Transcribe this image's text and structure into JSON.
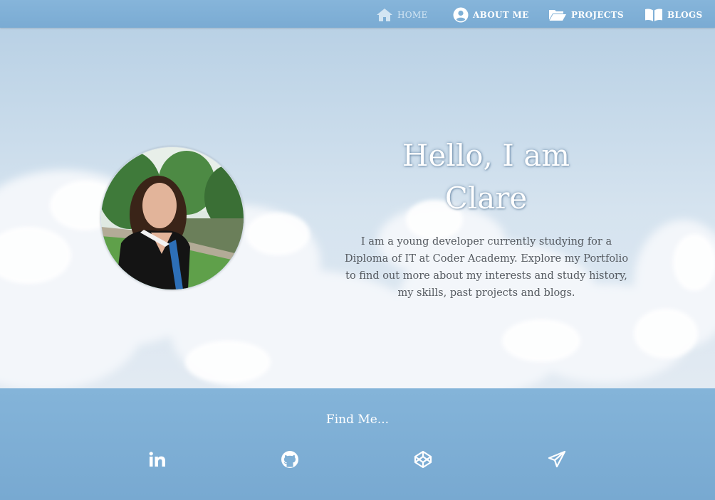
{
  "nav": {
    "items": [
      {
        "label": "HOME",
        "icon": "home-icon",
        "active": true
      },
      {
        "label": "ABOUT ME",
        "icon": "user-circle-icon",
        "active": false
      },
      {
        "label": "PROJECTS",
        "icon": "folder-open-icon",
        "active": false
      },
      {
        "label": "BLOGS",
        "icon": "book-icon",
        "active": false
      }
    ]
  },
  "hero": {
    "title_line1": "Hello, I am",
    "title_line2": "Clare",
    "intro": "I am a young developer currently studying for a Diploma of IT at Coder Academy. Explore my Portfolio to find out more about my interests and study history, my skills, past projects and blogs."
  },
  "footer": {
    "heading": "Find Me...",
    "social": [
      {
        "icon": "linkedin-icon"
      },
      {
        "icon": "github-icon"
      },
      {
        "icon": "codepen-icon"
      },
      {
        "icon": "telegram-icon"
      }
    ]
  },
  "colors": {
    "nav_background": "#7fb0d6",
    "footer_background": "#7eafd5",
    "title_text": "#ffffff",
    "intro_text": "#555a60"
  }
}
